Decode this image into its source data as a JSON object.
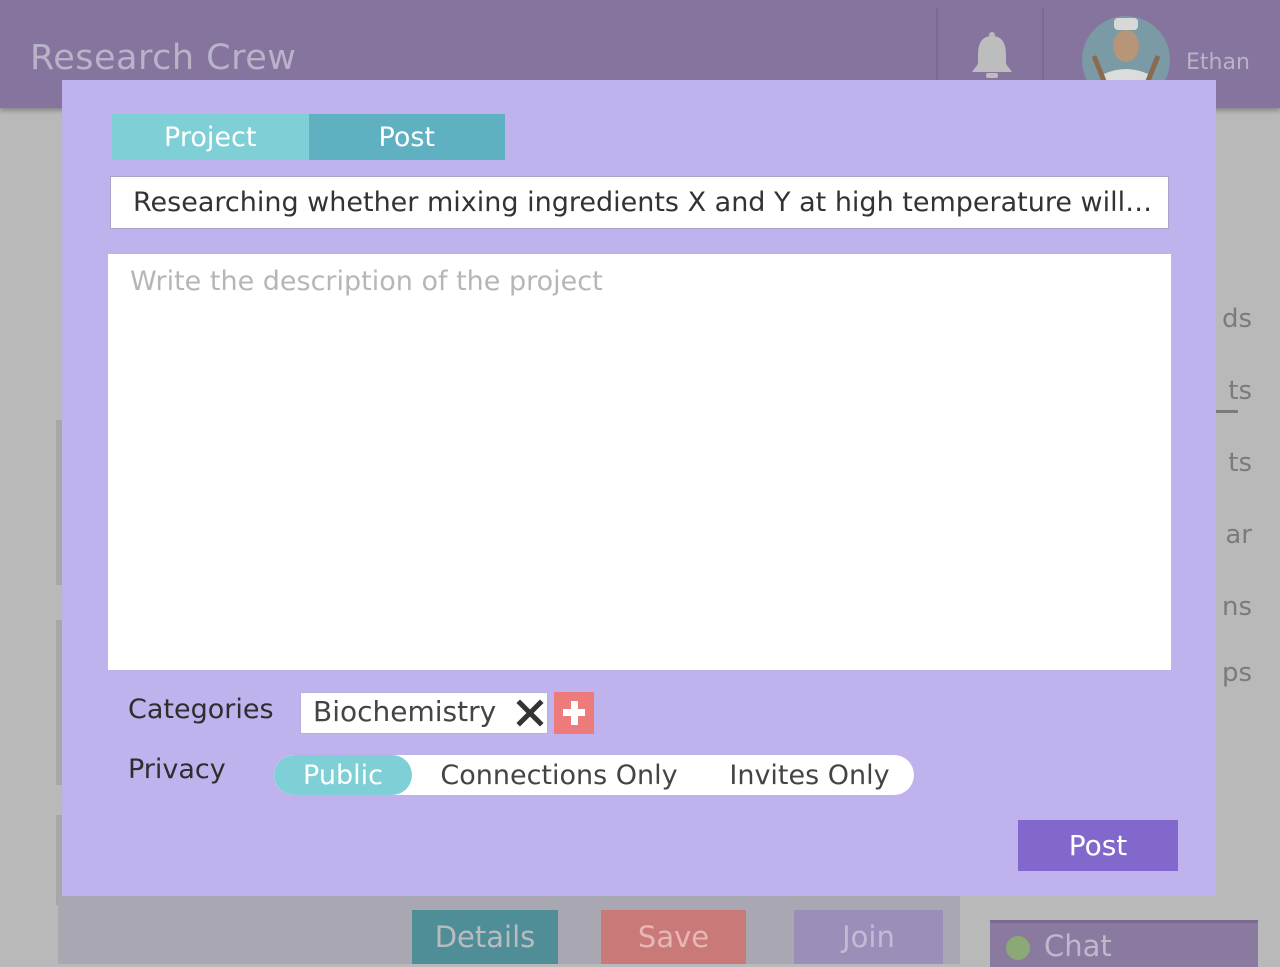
{
  "app": {
    "brand": "Research Crew",
    "username": "Ethan"
  },
  "sidebar_fragments": [
    "ds",
    "ts",
    "ts",
    "ar",
    "ns",
    "ps"
  ],
  "background_buttons": {
    "details": "Details",
    "save": "Save",
    "join": "Join"
  },
  "chat": {
    "label": "Chat"
  },
  "modal": {
    "tabs": [
      {
        "label": "Project",
        "active": true
      },
      {
        "label": "Post",
        "active": false
      }
    ],
    "title_value": "Researching whether mixing ingredients X and Y at high temperature will produce",
    "description_placeholder": "Write the description of the project",
    "categories_label": "Categories",
    "categories": [
      "Biochemistry"
    ],
    "privacy_label": "Privacy",
    "privacy_options": [
      {
        "label": "Public",
        "selected": true
      },
      {
        "label": "Connections Only",
        "selected": false
      },
      {
        "label": "Invites Only",
        "selected": false
      }
    ],
    "post_button": "Post"
  },
  "colors": {
    "modal_bg": "#c0b3ed",
    "tab_active": "#7ed0d6",
    "tab_inactive": "#5fb1c2",
    "post_button": "#8268cc",
    "add_button": "#ed7b7b"
  }
}
